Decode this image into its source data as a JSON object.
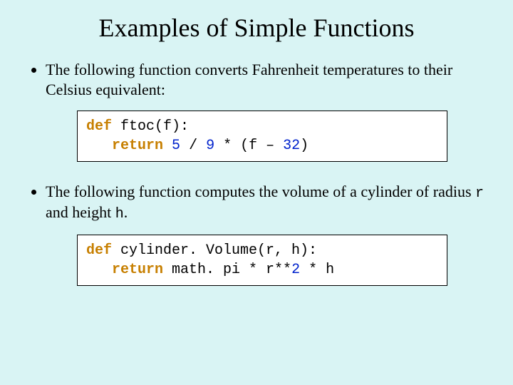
{
  "title": "Examples of Simple Functions",
  "bullets": [
    {
      "text_before": "The following function converts Fahrenheit temperatures to their Celsius equivalent:",
      "code_parts": {
        "kw_def": "def",
        "fn": " ftoc(f):",
        "indent": "   ",
        "kw_return": "return",
        "sp1": " ",
        "n5": "5",
        "op1": " / ",
        "n9": "9",
        "op2": " * (f – ",
        "n32": "32",
        "close": ")"
      }
    },
    {
      "text_parts": {
        "t1": "The following function computes the volume of a cylinder of radius ",
        "c1": "r",
        "t2": " and height ",
        "c2": "h",
        "t3": "."
      },
      "code_parts": {
        "kw_def": "def",
        "fn": " cylinder. Volume(r, h):",
        "indent": "   ",
        "kw_return": "return",
        "rest_a": " math. pi * r**",
        "n2": "2",
        "rest_b": " * h"
      }
    }
  ]
}
